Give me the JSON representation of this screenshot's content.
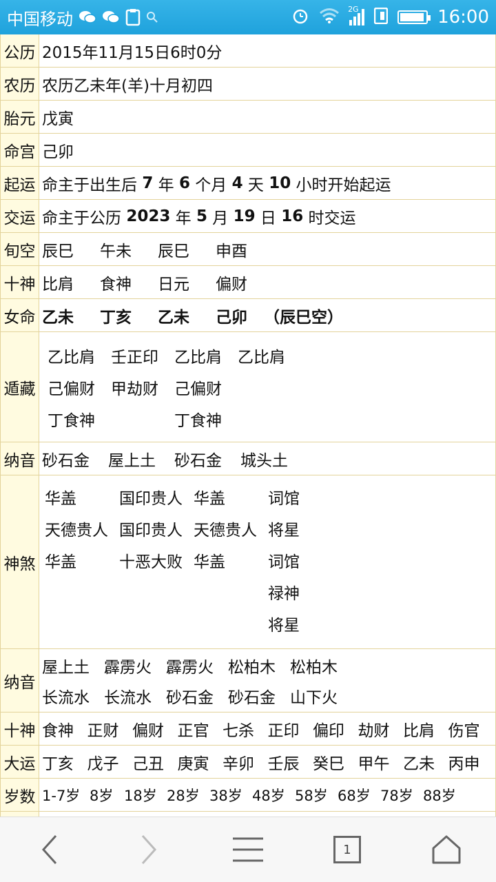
{
  "status": {
    "carrier": "中国移动",
    "network": "2G",
    "time": "16:00"
  },
  "rows": {
    "gongli": {
      "label": "公历",
      "value": "2015年11月15日6时0分"
    },
    "nongli": {
      "label": "农历",
      "value": "农历乙未年(羊)十月初四"
    },
    "taiyuan": {
      "label": "胎元",
      "value": "戊寅"
    },
    "minggong": {
      "label": "命宫",
      "value": "己卯"
    },
    "qiyun": {
      "label": "起运",
      "p1": "命主于出生后 ",
      "n1": "7",
      "p2": " 年 ",
      "n2": "6",
      "p3": " 个月 ",
      "n3": "4",
      "p4": " 天 ",
      "n4": "10",
      "p5": " 小时开始起运"
    },
    "jiaoyun": {
      "label": "交运",
      "p1": "命主于公历 ",
      "n1": "2023",
      "p2": " 年 ",
      "n2": "5",
      "p3": " 月 ",
      "n3": "19",
      "p4": " 日 ",
      "n4": "16",
      "p5": " 时交运"
    },
    "xunkong": {
      "label": "旬空",
      "items": [
        "辰巳",
        "午未",
        "辰巳",
        "申酉"
      ]
    },
    "shishen": {
      "label": "十神",
      "items": [
        "比肩",
        "食神",
        "日元",
        "偏财"
      ]
    },
    "nvming": {
      "label": "女命",
      "items": [
        "乙未",
        "丁亥",
        "乙未",
        "己卯"
      ],
      "kong": "（辰巳空）"
    },
    "dunzang": {
      "label": "遁藏",
      "lines": [
        [
          "乙比肩",
          "壬正印",
          "乙比肩",
          "乙比肩"
        ],
        [
          "己偏财",
          "甲劫财",
          "己偏财",
          ""
        ],
        [
          "丁食神",
          "",
          "丁食神",
          ""
        ]
      ]
    },
    "nayin1": {
      "label": "纳音",
      "items": [
        "砂石金",
        "屋上土",
        "砂石金",
        "城头土"
      ]
    },
    "shensha": {
      "label": "神煞",
      "lines": [
        [
          "华盖",
          "国印贵人",
          "华盖",
          "词馆"
        ],
        [
          "天德贵人",
          "国印贵人",
          "天德贵人",
          "将星"
        ],
        [
          "华盖",
          "十恶大败",
          "华盖",
          "词馆"
        ],
        [
          "",
          "",
          "",
          "禄神"
        ],
        [
          "",
          "",
          "",
          "将星"
        ]
      ]
    },
    "nayin2": {
      "label": "纳音",
      "line1": [
        "屋上土",
        "霹雳火",
        "霹雳火",
        "松柏木",
        "松柏木"
      ],
      "line2": [
        "长流水",
        "长流水",
        "砂石金",
        "砂石金",
        "山下火"
      ]
    },
    "shishen2": {
      "label": "十神",
      "items": [
        "食神",
        "正财",
        "偏财",
        "正官",
        "七杀",
        "正印",
        "偏印",
        "劫财",
        "比肩",
        "伤官"
      ]
    },
    "dayun": {
      "label": "大运",
      "items": [
        "丁亥",
        "戊子",
        "己丑",
        "庚寅",
        "辛卯",
        "壬辰",
        "癸巳",
        "甲午",
        "乙未",
        "丙申"
      ]
    },
    "suishu": {
      "label": "岁数",
      "items": [
        "1-7岁",
        "8岁",
        "18岁",
        "28岁",
        "38岁",
        "48岁",
        "58岁",
        "68岁",
        "78岁",
        "88岁"
      ]
    }
  },
  "nav": {
    "tab_count": "1"
  },
  "colors": {
    "blue": "#1f2fa8",
    "red": "#d8121c",
    "green": "#3d8a12",
    "label_bg": "#fffbe0",
    "statusbar": "#1fa2dc"
  }
}
